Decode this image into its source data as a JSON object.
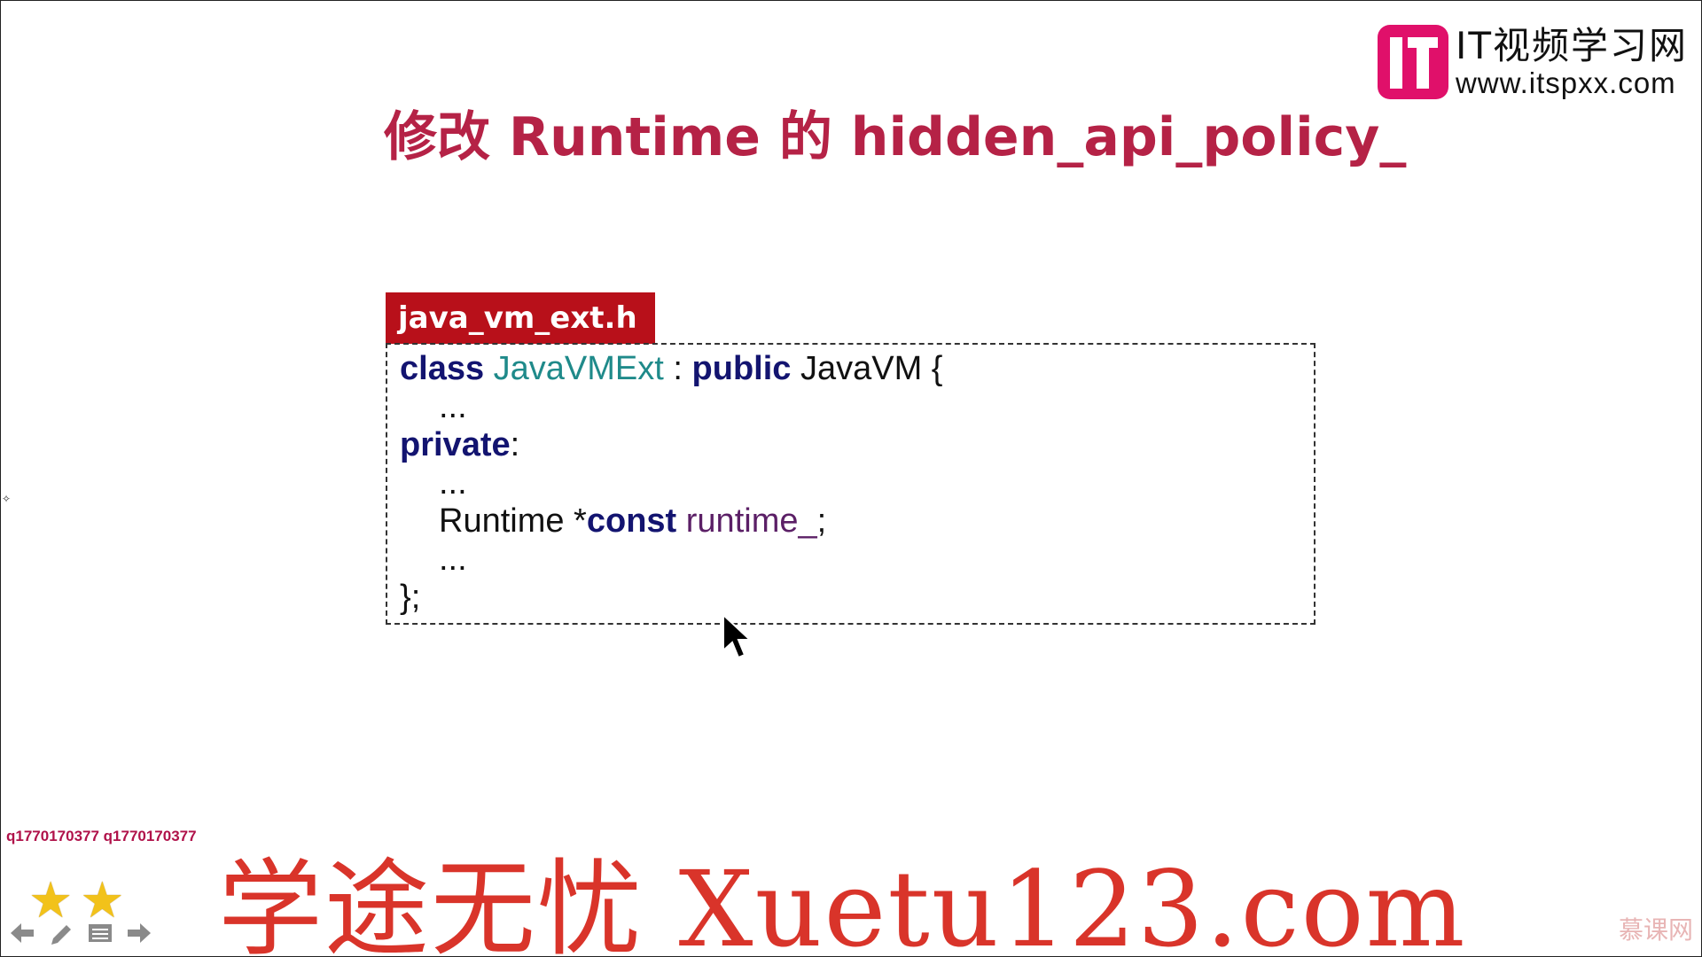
{
  "logo": {
    "title": "IT视频学习网",
    "url": "www.itspxx.com"
  },
  "slide": {
    "title": "修改 Runtime 的 hidden_api_policy_",
    "file_tab": "java_vm_ext.h",
    "code": {
      "line1": {
        "kw1": "class",
        "cls": "JavaVMExt",
        "sep": " : ",
        "kw2": "public",
        "rest": " JavaVM {"
      },
      "line2": "...",
      "line3": {
        "kw": "private",
        "rest": ":"
      },
      "line4": "...",
      "line5": {
        "pre": "Runtime *",
        "kw": "const",
        "var": "runtime_",
        "rest": ";"
      },
      "line6": "...",
      "line7": "};"
    }
  },
  "overlay": {
    "qq": "q1770170377 q1770170377",
    "watermark": "学途无忧 Xuetu123.com",
    "stars": [
      "★",
      "★"
    ],
    "site_mark": "慕课网"
  },
  "colors": {
    "title": "#b52246",
    "tab": "#b8101a",
    "keyword": "#131470",
    "class_name": "#1f8a8a",
    "variable": "#5b1f66",
    "logo_pink": "#e0106a",
    "watermark": "#d9342a"
  }
}
